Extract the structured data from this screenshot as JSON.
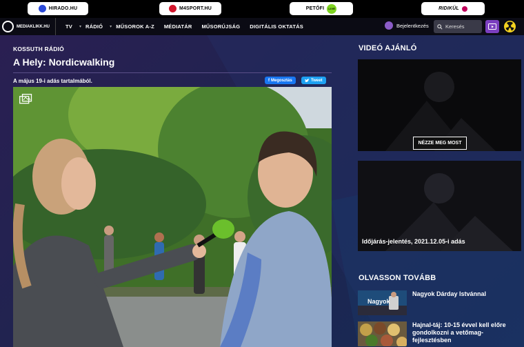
{
  "top_sites": [
    {
      "label": "HIRADO.HU",
      "dot": "#2b4ad8"
    },
    {
      "label": "M4SPORT.HU",
      "dot": "#d1152b"
    },
    {
      "label": "PETŐFI",
      "badge": "LIVE",
      "dot": "#7ed320"
    },
    {
      "label": "RIDIKÜL",
      "dot": "#c0005a"
    }
  ],
  "nav": {
    "logo": "MEDIAKLIKK.HU",
    "items": [
      "TV",
      "RÁDIÓ",
      "MŰSOROK A-Z",
      "MÉDIATÁR",
      "MŰSORÚJSÁG",
      "DIGITÁLIS OKTATÁS"
    ],
    "login": "Bejelentkezés",
    "search_placeholder": "Keresés"
  },
  "article": {
    "section": "KOSSUTH RÁDIÓ",
    "title": "A Hely: Nordicwalking",
    "subtitle": "A május 19-i adás tartalmából.",
    "share_facebook": "Megosztás",
    "share_twitter": "Tweet"
  },
  "sidebar": {
    "video_heading": "VIDEÓ AJÁNLÓ",
    "watch_label": "NÉZZE MEG MOST",
    "video2_caption": "Időjárás-jelentés, 2021.12.05-i adás",
    "read_heading": "OLVASSON TOVÁBB",
    "thumb1_text": "Nagyok",
    "items": [
      "Nagyok Dárday Istvánnal",
      "Hajnal-táj: 10-15 évvel kell előre gondolkozni a vetőmag-fejlesztésben"
    ]
  },
  "colors": {
    "accent_purple": "#7b3fc0",
    "facebook": "#1877f2",
    "twitter": "#1da1f2",
    "radio_yellow": "#f4d21f"
  }
}
